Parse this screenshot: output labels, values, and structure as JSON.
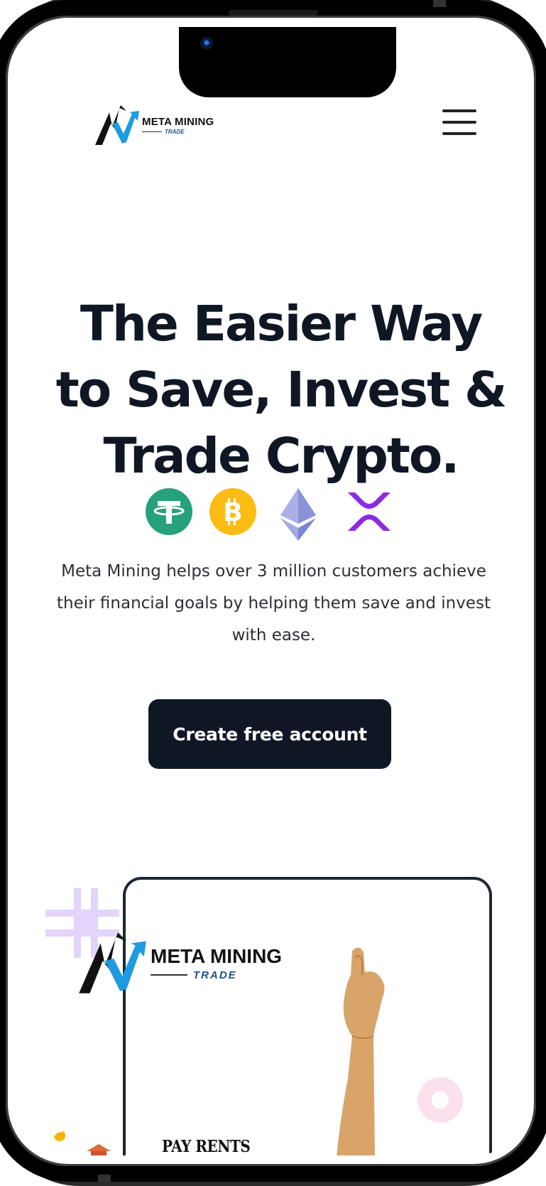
{
  "header": {
    "logo": {
      "name": "META MINING",
      "sub": "TRADE"
    },
    "menu_label": "Menu"
  },
  "hero": {
    "title_lines": [
      "The Easier Way",
      "to Save, Invest &",
      "Trade Crypto."
    ],
    "coins": [
      {
        "name": "tether",
        "icon": "tether-icon",
        "color": "#26a17b"
      },
      {
        "name": "bitcoin",
        "icon": "bitcoin-icon",
        "color": "#fbbc13"
      },
      {
        "name": "ethereum",
        "icon": "ethereum-icon",
        "color": "#7b86d6"
      },
      {
        "name": "xrp",
        "icon": "xrp-icon",
        "color": "#8a2be2"
      }
    ],
    "description": "Meta Mining helps over 3 million customers achieve their financial goals by helping them save and invest with ease.",
    "cta_label": "Create free account"
  },
  "promo": {
    "logo": {
      "name": "META MINING",
      "sub": "TRADE"
    },
    "caption": "PAY RENTS",
    "colors": {
      "plus": "#e2d4fb",
      "ring": "#fbe1ee",
      "card_border": "#1f2633"
    }
  },
  "colors": {
    "primary": "#0f1725",
    "logo_blue": "#1e9be0"
  }
}
